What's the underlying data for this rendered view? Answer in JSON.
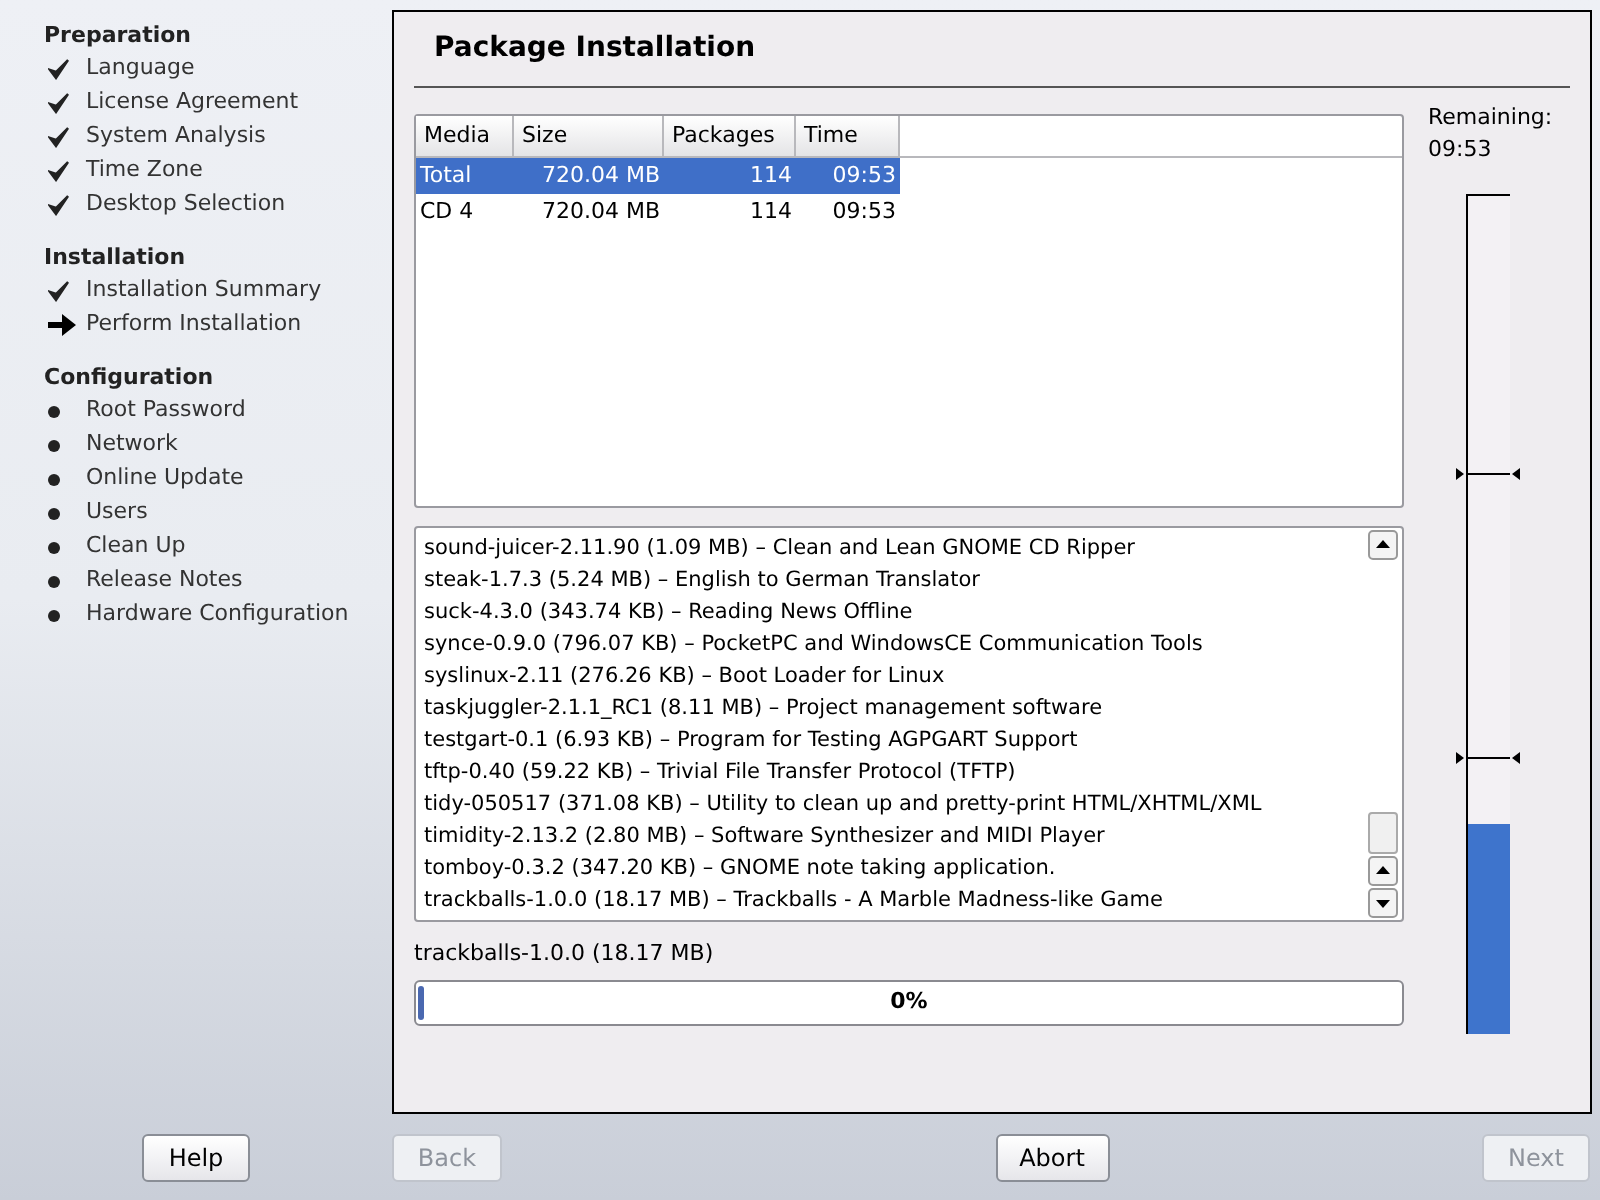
{
  "sidebar": {
    "sections": [
      {
        "title": "Preparation",
        "items": [
          {
            "label": "Language",
            "kind": "done"
          },
          {
            "label": "License Agreement",
            "kind": "done"
          },
          {
            "label": "System Analysis",
            "kind": "done"
          },
          {
            "label": "Time Zone",
            "kind": "done"
          },
          {
            "label": "Desktop Selection",
            "kind": "done"
          }
        ]
      },
      {
        "title": "Installation",
        "items": [
          {
            "label": "Installation Summary",
            "kind": "done"
          },
          {
            "label": "Perform Installation",
            "kind": "current"
          }
        ]
      },
      {
        "title": "Configuration",
        "items": [
          {
            "label": "Root Password",
            "kind": "pending"
          },
          {
            "label": "Network",
            "kind": "pending"
          },
          {
            "label": "Online Update",
            "kind": "pending"
          },
          {
            "label": "Users",
            "kind": "pending"
          },
          {
            "label": "Clean Up",
            "kind": "pending"
          },
          {
            "label": "Release Notes",
            "kind": "pending"
          },
          {
            "label": "Hardware Configuration",
            "kind": "pending"
          }
        ]
      }
    ]
  },
  "panel": {
    "title": "Package Installation",
    "table": {
      "columns": [
        "Media",
        "Size",
        "Packages",
        "Time"
      ],
      "rows": [
        {
          "cells": [
            "Total",
            "720.04 MB",
            "114",
            "09:53"
          ],
          "selected": true
        },
        {
          "cells": [
            "CD 4",
            "720.04 MB",
            "114",
            "09:53"
          ],
          "selected": false
        }
      ]
    },
    "log": [
      "sound-juicer-2.11.90 (1.09 MB) – Clean and Lean GNOME CD Ripper",
      "steak-1.7.3 (5.24 MB) – English to German Translator",
      "suck-4.3.0 (343.74 KB) – Reading News Offline",
      "synce-0.9.0 (796.07 KB) – PocketPC and WindowsCE Communication Tools",
      "syslinux-2.11 (276.26 KB) – Boot Loader for Linux",
      "taskjuggler-2.1.1_RC1 (8.11 MB) – Project management software",
      "testgart-0.1 (6.93 KB) – Program for Testing AGPGART Support",
      "tftp-0.40 (59.22 KB) – Trivial File Transfer Protocol (TFTP)",
      "tidy-050517 (371.08 KB) – Utility to clean up and pretty-print HTML/XHTML/XML",
      "timidity-2.13.2 (2.80 MB) – Software Synthesizer and MIDI Player",
      "tomboy-0.3.2 (347.20 KB) – GNOME note taking application.",
      "trackballs-1.0.0 (18.17 MB) – Trackballs - A Marble Madness-like Game"
    ],
    "current_package": "trackballs-1.0.0 (18.17 MB)",
    "progress": {
      "label": "0%",
      "level": 0
    },
    "remaining": {
      "label": "Remaining:",
      "time": "09:53",
      "level": 0.25
    }
  },
  "buttons": [
    {
      "label": "Help",
      "disabled": false
    },
    {
      "label": "Back",
      "disabled": true
    },
    {
      "label": "Abort",
      "disabled": false
    },
    {
      "label": "Next",
      "disabled": true
    }
  ]
}
